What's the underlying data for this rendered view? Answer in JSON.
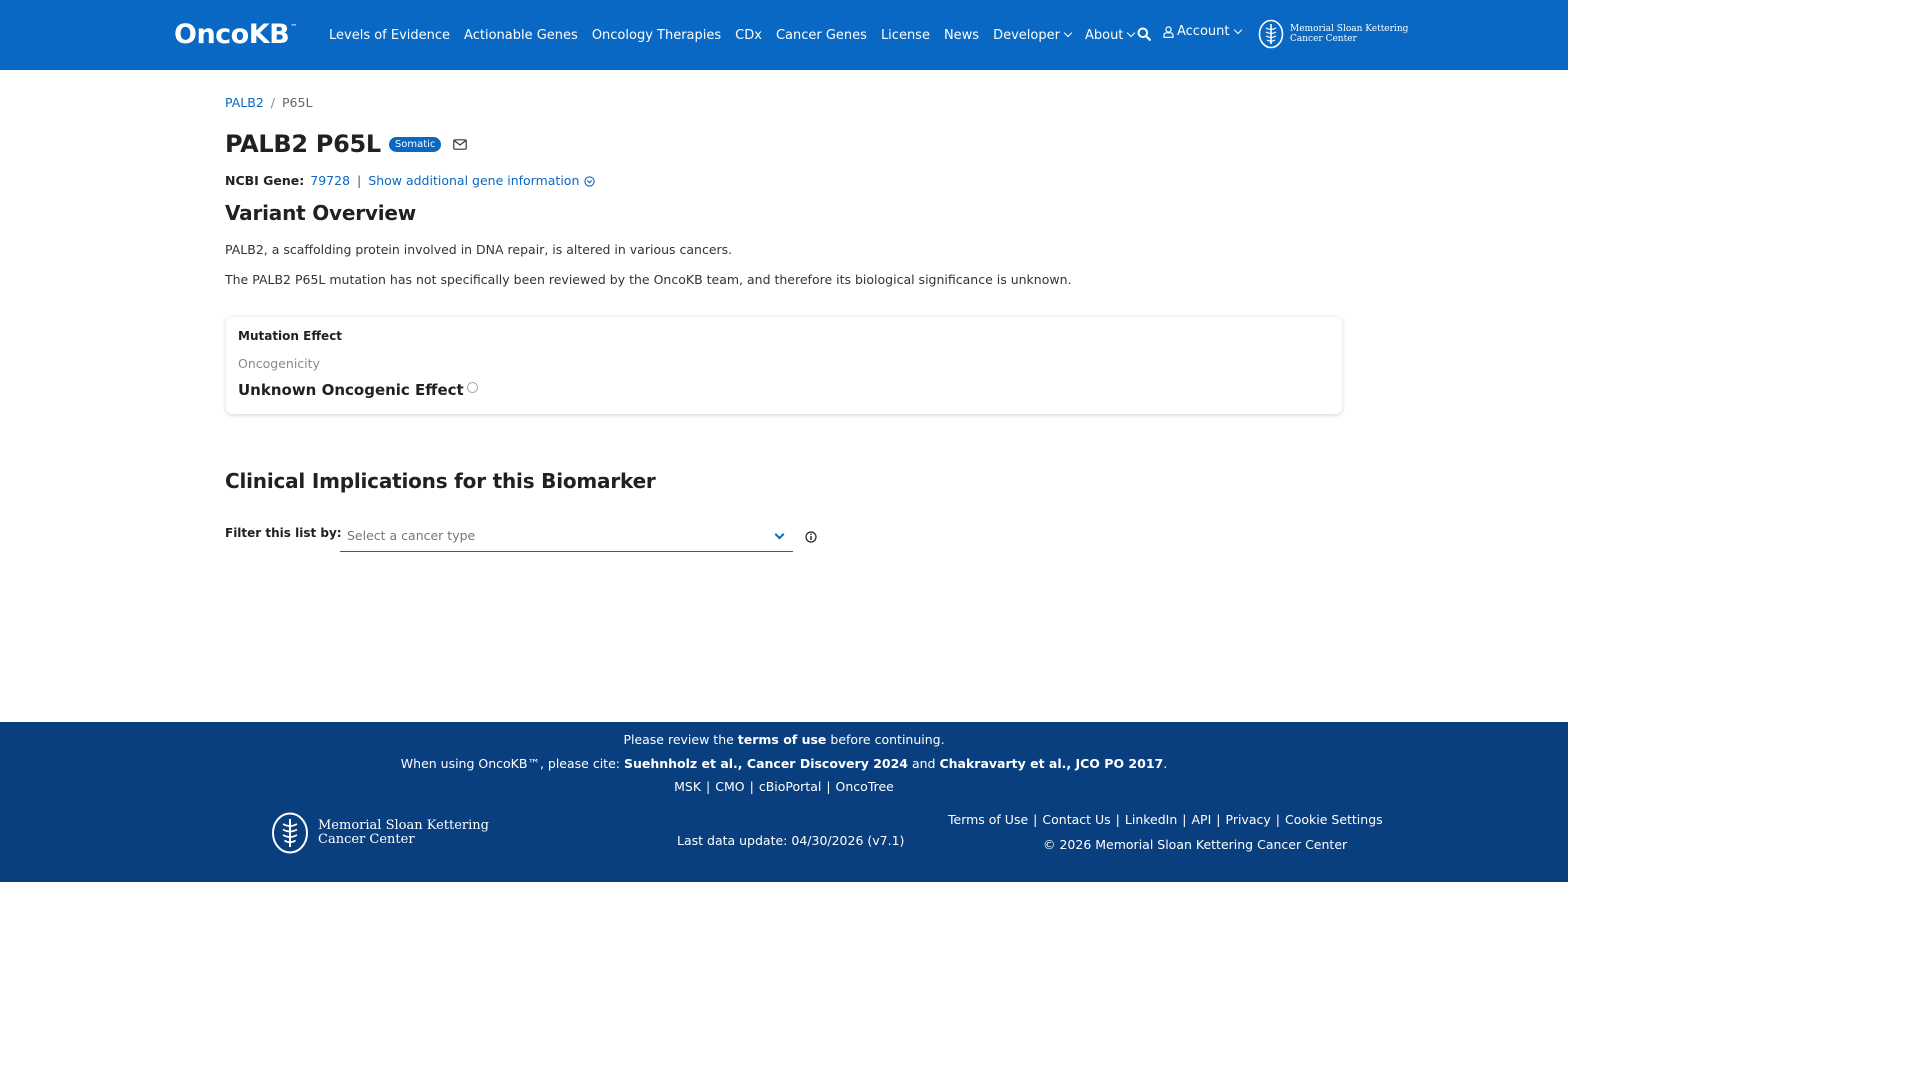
{
  "header": {
    "logo": "OncoKB",
    "logo_tm": "™",
    "nav": [
      {
        "label": "Levels of Evidence"
      },
      {
        "label": "Actionable Genes"
      },
      {
        "label": "Oncology Therapies"
      },
      {
        "label": "CDx"
      },
      {
        "label": "Cancer Genes"
      },
      {
        "label": "License"
      },
      {
        "label": "News"
      },
      {
        "label": "Developer"
      },
      {
        "label": "About"
      }
    ],
    "account_label": "Account",
    "msk_line1": "Memorial Sloan Kettering",
    "msk_line2": "Cancer Center"
  },
  "breadcrumb": {
    "gene": "PALB2",
    "sep": "/",
    "variant": "P65L"
  },
  "title": {
    "text": "PALB2 P65L",
    "badge": "Somatic"
  },
  "gene_info": {
    "label": "NCBI Gene:",
    "ncbi_id": "79728",
    "sep": "|",
    "show_more": "Show additional gene information"
  },
  "overview": {
    "heading": "Variant Overview",
    "para1": "PALB2, a scaffolding protein involved in DNA repair, is altered in various cancers.",
    "para2": "The PALB2 P65L mutation has not specifically been reviewed by the OncoKB team, and therefore its biological significance is unknown."
  },
  "mutation_effect": {
    "heading": "Mutation Effect",
    "label": "Oncogenicity",
    "value": "Unknown Oncogenic Effect"
  },
  "clinical": {
    "heading": "Clinical Implications for this Biomarker",
    "filter_label": "Filter this list by:",
    "select_placeholder": "Select a cancer type"
  },
  "footer": {
    "review_pre": "Please review the ",
    "review_link": "terms of use",
    "review_post": " before continuing.",
    "cite_pre": "When using OncoKB™, please cite: ",
    "cite_1": "Suehnholz et al., Cancer Discovery 2024",
    "cite_and": " and ",
    "cite_2": "Chakravarty et al., JCO PO 2017",
    "cite_end": ".",
    "links": [
      "MSK",
      "CMO",
      "cBioPortal",
      "OncoTree"
    ],
    "sep": "|",
    "msk_line1": "Memorial Sloan Kettering",
    "msk_line2": "Cancer Center",
    "last_update": "Last data update: 04/30/2026 (v7.1)",
    "right_links": [
      "Terms of Use",
      "Contact Us",
      "LinkedIn",
      "API",
      "Privacy",
      "Cookie Settings"
    ],
    "copyright": "© 2026 Memorial Sloan Kettering Cancer Center"
  },
  "colors": {
    "brand_blue": "#0968c3",
    "footer_blue": "#0a3f7f"
  },
  "icons": [
    "search-icon",
    "user-icon",
    "msk-logo-icon",
    "mail-icon",
    "chevron-circle-icon",
    "info-icon",
    "dropdown-chevron-icon"
  ]
}
